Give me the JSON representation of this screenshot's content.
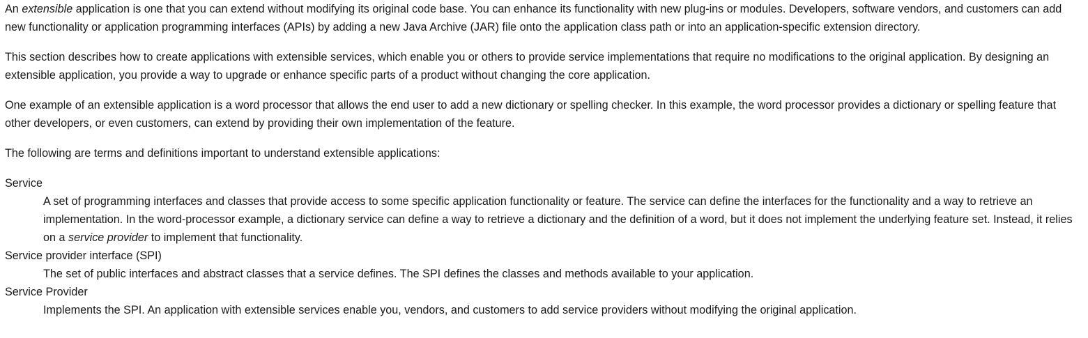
{
  "intro": {
    "p1_before": "An ",
    "p1_em": "extensible",
    "p1_after": " application is one that you can extend without modifying its original code base. You can enhance its functionality with new plug-ins or modules. Developers, software vendors, and customers can add new functionality or application programming interfaces (APIs) by adding a new Java Archive (JAR) file onto the application class path or into an application-specific extension directory.",
    "p2": "This section describes how to create applications with extensible services, which enable you or others to provide service implementations that require no modifications to the original application. By designing an extensible application, you provide a way to upgrade or enhance specific parts of a product without changing the core application.",
    "p3": "One example of an extensible application is a word processor that allows the end user to add a new dictionary or spelling checker. In this example, the word processor provides a dictionary or spelling feature that other developers, or even customers, can extend by providing their own implementation of the feature.",
    "p4": "The following are terms and definitions important to understand extensible applications:"
  },
  "definitions": [
    {
      "term": "Service",
      "def_before": "A set of programming interfaces and classes that provide access to some specific application functionality or feature. The service can define the interfaces for the functionality and a way to retrieve an implementation. In the word-processor example, a dictionary service can define a way to retrieve a dictionary and the definition of a word, but it does not implement the underlying feature set. Instead, it relies on a ",
      "def_em": "service provider",
      "def_after": " to implement that functionality."
    },
    {
      "term": "Service provider interface (SPI)",
      "def": "The set of public interfaces and abstract classes that a service defines. The SPI defines the classes and methods available to your application."
    },
    {
      "term": "Service Provider",
      "def": "Implements the SPI. An application with extensible services enable you, vendors, and customers to add service providers without modifying the original application."
    }
  ]
}
